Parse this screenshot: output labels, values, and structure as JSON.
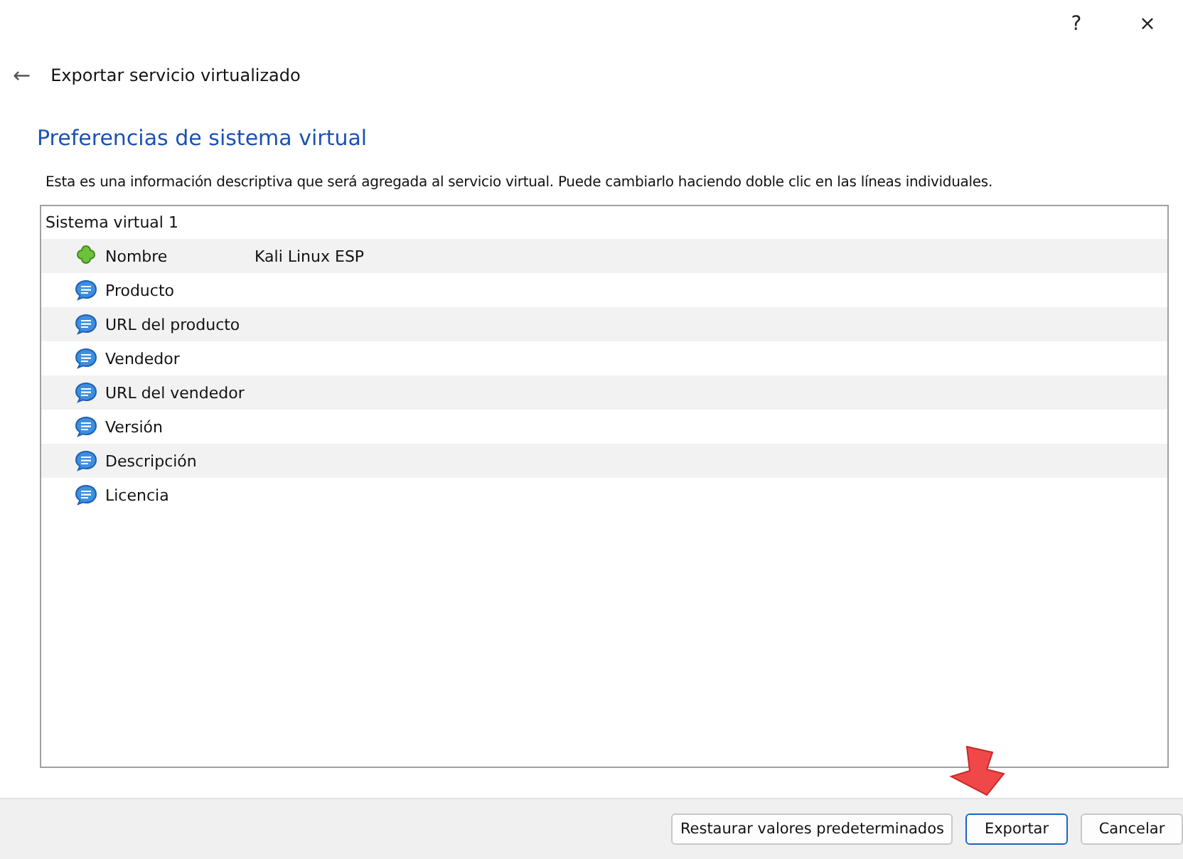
{
  "window": {
    "help": "?",
    "close": "×"
  },
  "header": {
    "back": "←",
    "title": "Exportar servicio virtualizado"
  },
  "page": {
    "heading": "Preferencias de sistema virtual",
    "description": "Esta es una información descriptiva que será agregada al servicio virtual. Puede cambiarlo haciendo doble clic en las líneas individuales."
  },
  "tree": {
    "root": "Sistema virtual 1",
    "rows": [
      {
        "kind": "name",
        "label": "Nombre",
        "value": "Kali Linux ESP"
      },
      {
        "kind": "text",
        "label": "Producto"
      },
      {
        "kind": "text",
        "label": "URL del producto"
      },
      {
        "kind": "text",
        "label": "Vendedor"
      },
      {
        "kind": "text",
        "label": "URL del vendedor"
      },
      {
        "kind": "text",
        "label": "Versión"
      },
      {
        "kind": "text",
        "label": "Descripción"
      },
      {
        "kind": "text",
        "label": "Licencia"
      }
    ]
  },
  "buttons": [
    {
      "label": "Restaurar valores predeterminados",
      "default": false
    },
    {
      "label": "Exportar",
      "default": true
    },
    {
      "label": "Cancelar",
      "default": false
    }
  ]
}
